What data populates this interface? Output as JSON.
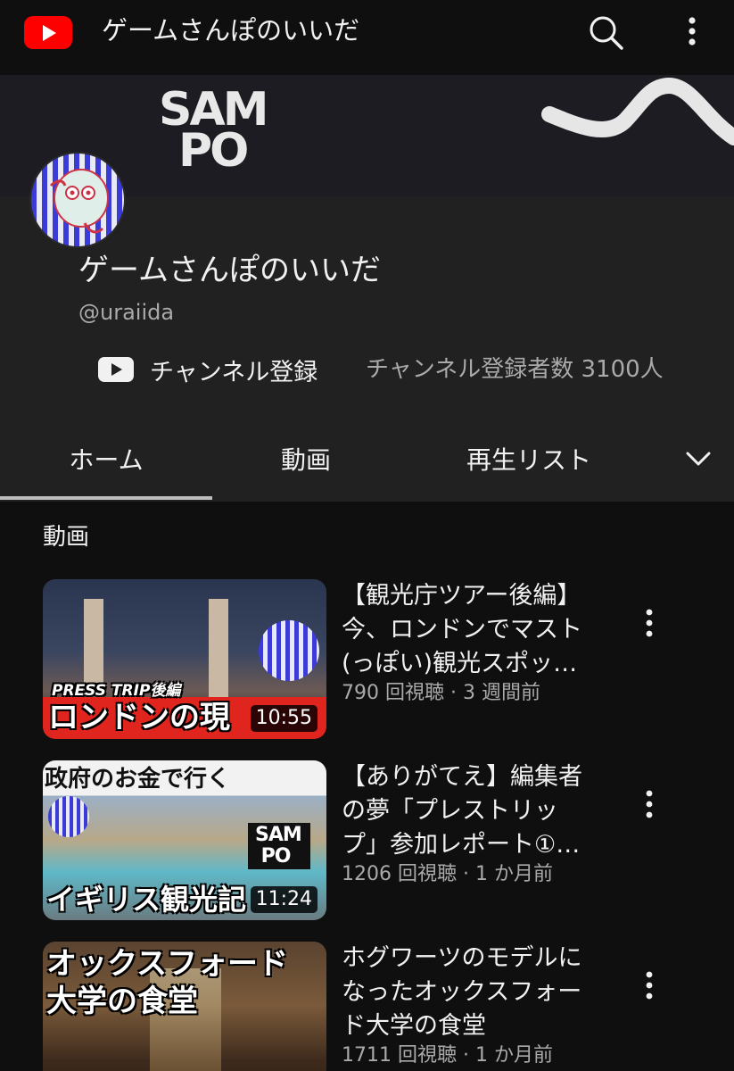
{
  "app": {
    "title": "ゲームさんぽのいいだ",
    "logo_icon": "youtube-logo-icon",
    "brand_color": "#ff0000"
  },
  "banner": {
    "logo_line1": "SAM",
    "logo_line2": "PO"
  },
  "channel": {
    "name": "ゲームさんぽのいいだ",
    "handle": "@uraiida",
    "subscribe_label": "チャンネル登録",
    "subscriber_count": "チャンネル登録者数 3100人"
  },
  "tabs": [
    {
      "label": "ホーム",
      "selected": true
    },
    {
      "label": "動画",
      "selected": false
    },
    {
      "label": "再生リスト",
      "selected": false
    }
  ],
  "section": {
    "title": "動画"
  },
  "videos": [
    {
      "title_lines": [
        "【観光庁ツアー後編】",
        "今、ロンドンでマスト",
        "(っぽい)観光スポッ…"
      ],
      "meta": "790 回視聴 · 3 週間前",
      "duration": "10:55",
      "thumb_caption_top": "PRESS TRIP後編",
      "thumb_caption_main": "ロンドンの現"
    },
    {
      "title_lines": [
        "【ありがてえ】編集者",
        "の夢「プレストリッ",
        "プ」参加レポート①…"
      ],
      "meta": "1206 回視聴 · 1 か月前",
      "duration": "11:24",
      "thumb_caption_top": "政府のお金で行く",
      "thumb_caption_main": "イギリス観光記"
    },
    {
      "title_lines": [
        "ホグワーツのモデルに",
        "なったオックスフォー",
        "ド大学の食堂"
      ],
      "meta": "1711 回視聴 · 1 か月前",
      "duration": "",
      "thumb_caption_top": "オックスフォード",
      "thumb_caption_main": "大学の食堂"
    }
  ]
}
